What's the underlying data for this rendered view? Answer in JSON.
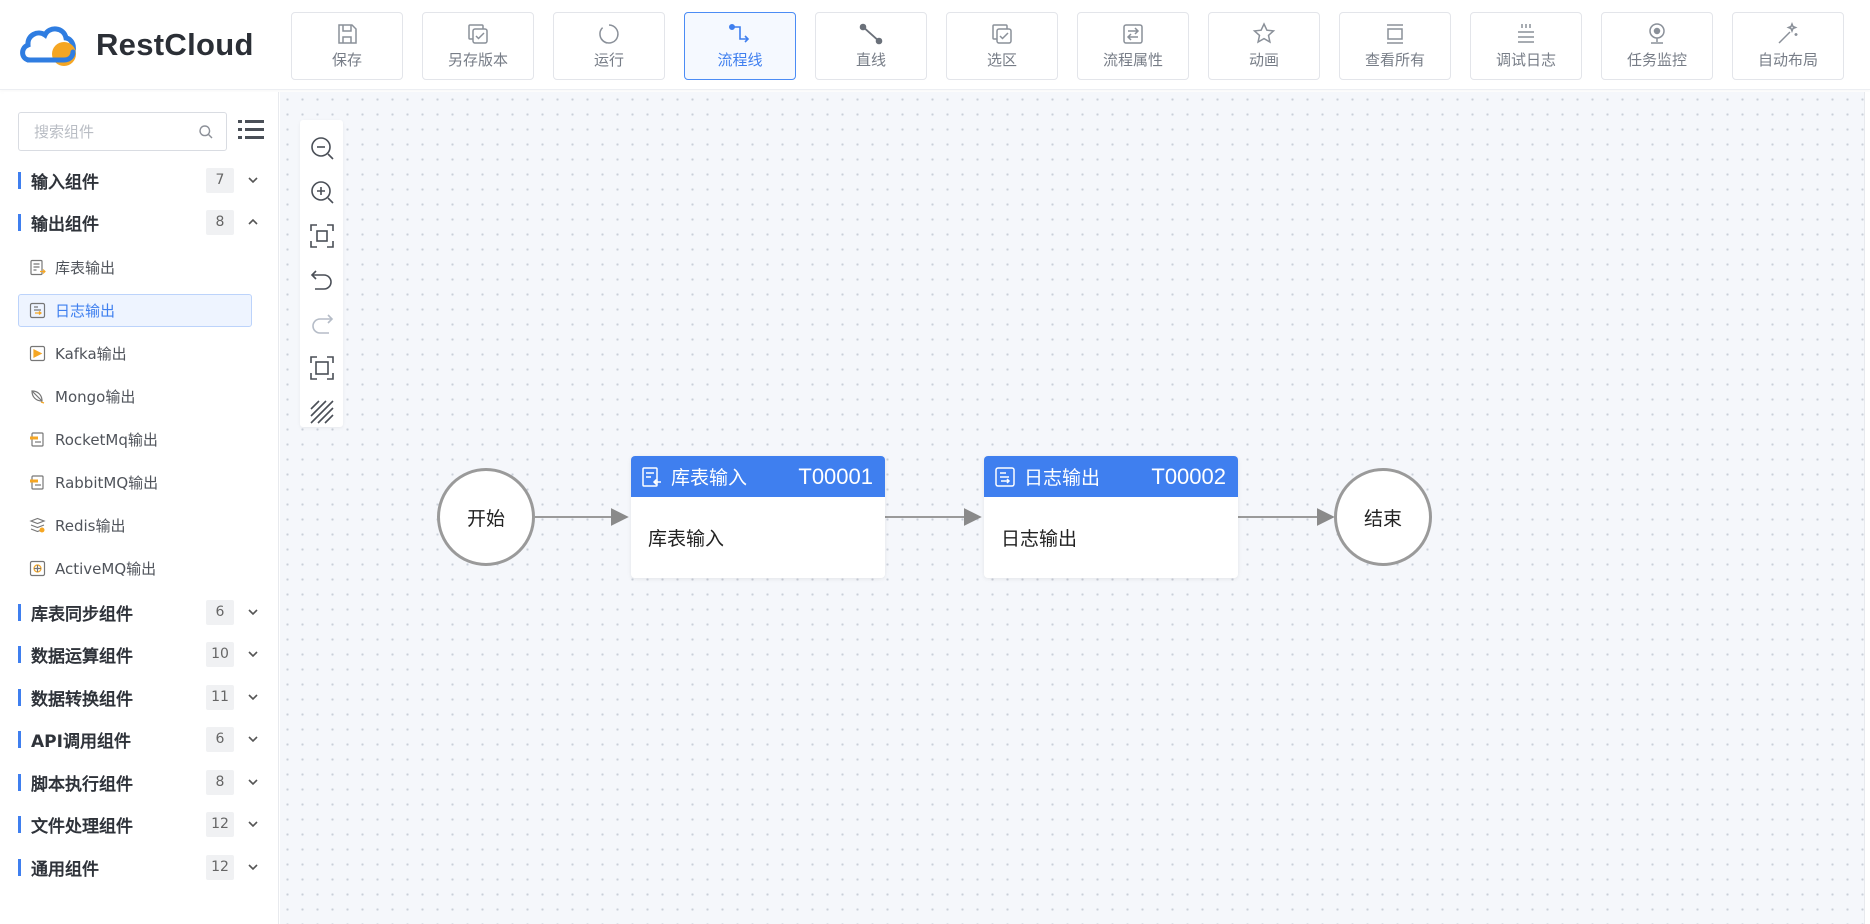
{
  "app": {
    "name": "RestCloud",
    "brand_colors": {
      "primary": "#3f7fef",
      "logo_blue": "#2f7de1",
      "logo_orange": "#f5a623"
    }
  },
  "toolbar": {
    "buttons": [
      {
        "label": "保存",
        "icon": "save-icon"
      },
      {
        "label": "另存版本",
        "icon": "copy-check-icon"
      },
      {
        "label": "运行",
        "icon": "run-icon"
      },
      {
        "label": "流程线",
        "icon": "flowline-icon",
        "active": true
      },
      {
        "label": "直线",
        "icon": "straight-line-icon"
      },
      {
        "label": "选区",
        "icon": "selection-icon"
      },
      {
        "label": "流程属性",
        "icon": "properties-icon"
      },
      {
        "label": "动画",
        "icon": "animation-star-icon"
      },
      {
        "label": "查看所有",
        "icon": "view-all-icon"
      },
      {
        "label": "调试日志",
        "icon": "debug-log-icon"
      },
      {
        "label": "任务监控",
        "icon": "monitor-camera-icon"
      },
      {
        "label": "自动布局",
        "icon": "magic-wand-icon"
      }
    ]
  },
  "sidebar": {
    "search_placeholder": "搜索组件",
    "groups": [
      {
        "name": "输入组件",
        "count": "7",
        "expanded": false
      },
      {
        "name": "输出组件",
        "count": "8",
        "expanded": true,
        "items": [
          {
            "name": "库表输出",
            "icon": "table-output-icon"
          },
          {
            "name": "日志输出",
            "icon": "log-output-icon",
            "selected": true
          },
          {
            "name": "Kafka输出",
            "icon": "kafka-icon"
          },
          {
            "name": "Mongo输出",
            "icon": "mongo-leaf-icon"
          },
          {
            "name": "RocketMq输出",
            "icon": "rocketmq-icon"
          },
          {
            "name": "RabbitMQ输出",
            "icon": "rabbitmq-icon"
          },
          {
            "name": "Redis输出",
            "icon": "redis-icon"
          },
          {
            "name": "ActiveMQ输出",
            "icon": "activemq-icon"
          }
        ]
      },
      {
        "name": "库表同步组件",
        "count": "6",
        "expanded": false
      },
      {
        "name": "数据运算组件",
        "count": "10",
        "expanded": false
      },
      {
        "name": "数据转换组件",
        "count": "11",
        "expanded": false
      },
      {
        "name": "API调用组件",
        "count": "6",
        "expanded": false
      },
      {
        "name": "脚本执行组件",
        "count": "8",
        "expanded": false
      },
      {
        "name": "文件处理组件",
        "count": "12",
        "expanded": false
      },
      {
        "name": "通用组件",
        "count": "12",
        "expanded": false
      }
    ]
  },
  "canvas_tools": [
    {
      "icon": "zoom-out-icon"
    },
    {
      "icon": "zoom-in-icon"
    },
    {
      "icon": "fit-view-icon"
    },
    {
      "icon": "undo-icon"
    },
    {
      "icon": "redo-icon",
      "disabled": true
    },
    {
      "icon": "actual-size-icon"
    },
    {
      "icon": "grid-toggle-icon"
    }
  ],
  "flow": {
    "start": {
      "label": "开始"
    },
    "end": {
      "label": "结束"
    },
    "tasks": [
      {
        "title": "库表输入",
        "id": "T00001",
        "body": "库表输入",
        "icon": "table-input-icon"
      },
      {
        "title": "日志输出",
        "id": "T00002",
        "body": "日志输出",
        "icon": "log-output-icon"
      }
    ]
  }
}
